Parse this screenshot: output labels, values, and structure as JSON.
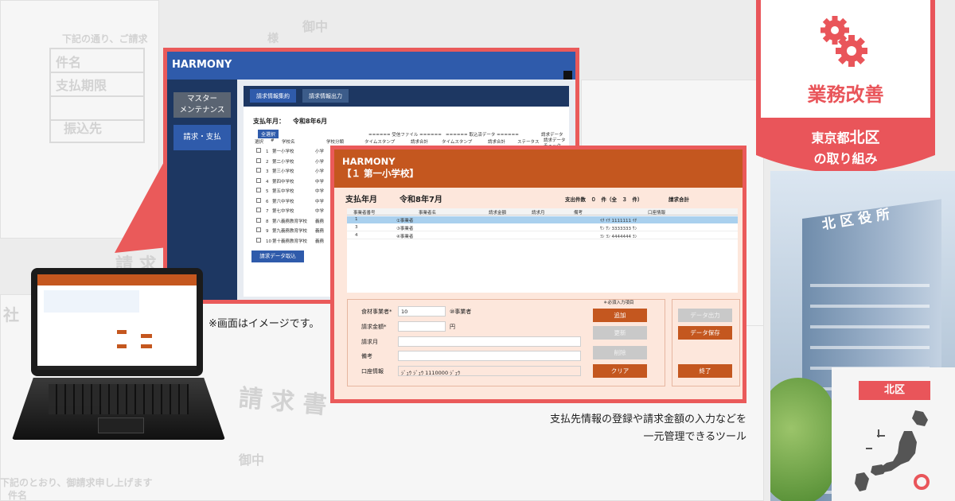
{
  "background_docs": {
    "chars": [
      "件名",
      "支払期限",
      "振込先",
      "御中",
      "様",
      "請 求",
      "請 求 書",
      "社",
      "御中",
      "下記の通り、ご請求",
      "下記のとおり、御請求申し上げます",
      "件名"
    ]
  },
  "window1": {
    "app_title": "HARMONY",
    "sidebar": [
      {
        "label": "マスター\nメンテナンス"
      },
      {
        "label": "請求・支払"
      }
    ],
    "tabs": [
      "請求情報集約",
      "請求情報出力"
    ],
    "pay_month_label": "支払年月：",
    "pay_month_value": "令和8年6月",
    "select_all": "全選択",
    "col_headers": [
      "選択",
      "#",
      "学校名",
      "学校分類",
      "タイムスタンプ",
      "請求合計",
      "タイムスタンプ",
      "請求合計",
      "ステータス",
      "請求データチェック"
    ],
    "group_headers": [
      "====== 受信ファイル ======",
      "====== 取込済データ ======",
      "請求データ"
    ],
    "rows": [
      {
        "no": "1",
        "name": "第一小学校",
        "cat": "小学"
      },
      {
        "no": "2",
        "name": "第二小学校",
        "cat": "小学"
      },
      {
        "no": "3",
        "name": "第三小学校",
        "cat": "小学"
      },
      {
        "no": "4",
        "name": "第四中学校",
        "cat": "中学"
      },
      {
        "no": "5",
        "name": "第五中学校",
        "cat": "中学"
      },
      {
        "no": "6",
        "name": "第六中学校",
        "cat": "中学"
      },
      {
        "no": "7",
        "name": "第七中学校",
        "cat": "中学"
      },
      {
        "no": "8",
        "name": "第八義務教育学校",
        "cat": "義務"
      },
      {
        "no": "9",
        "name": "第九義務教育学校",
        "cat": "義務"
      },
      {
        "no": "10",
        "name": "第十義務教育学校",
        "cat": "義務"
      }
    ],
    "import_button": "請求データ取込"
  },
  "window2": {
    "app_title": "HARMONY",
    "school": "【１ 第一小学校】",
    "pay_month_label": "支払年月",
    "pay_month_value": "令和8年7月",
    "payout_count": "支出件数　０　件（全　３　件）",
    "invoice_total": "請求合計",
    "col_headers": [
      "事業者番号",
      "事業者名",
      "請求金額",
      "請求月",
      "備考",
      "口座情報"
    ],
    "rows": [
      {
        "no": "1",
        "name": "①事業者",
        "account": "ｲﾁ ｲﾁ 1111111 ｲﾁ"
      },
      {
        "no": "3",
        "name": "③事業者",
        "account": "ｻﾝ ｻﾝ 3333333 ｻﾝ"
      },
      {
        "no": "4",
        "name": "④事業者",
        "account": "ﾖﾝ ﾖﾝ 4444444 ﾖﾝ"
      }
    ],
    "required_note": "＊必須入力項目",
    "form": {
      "vendor_label": "食材事業者*",
      "vendor_value": "10",
      "vendor_name": "⑩事業者",
      "amount_label": "請求金額*",
      "amount_unit": "円",
      "month_label": "請求月",
      "note_label": "備考",
      "account_label": "口座情報",
      "account_value": "ｼﾞｭｳ ｼﾞｭｳ 1110000 ｼﾞｭｳ"
    },
    "buttons": {
      "add": "追加",
      "update": "更新",
      "delete": "削除",
      "clear": "クリア",
      "output": "データ出力",
      "save": "データ保存",
      "end": "終了"
    }
  },
  "captions": {
    "image_note": "※画面はイメージです。",
    "desc_line1": "支払先情報の登録や請求金額の入力などを",
    "desc_line2": "一元管理できるツール"
  },
  "banner": {
    "title": "業務改善",
    "line1_pre": "東京都",
    "line1_hl": "北区",
    "line2": "の取り組み"
  },
  "building_sign": "北区役所",
  "map": {
    "label": "北区"
  },
  "colors": {
    "accent": "#e9555a",
    "harmony_blue": "#2f5bab",
    "harmony_navy": "#1d3762",
    "harmony_orange": "#c4571f",
    "panel_peach": "#fde7dc"
  }
}
